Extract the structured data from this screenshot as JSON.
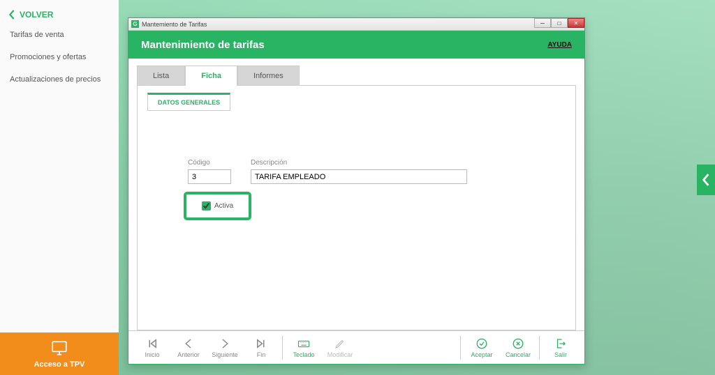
{
  "sidebar": {
    "back_label": "VOLVER",
    "items": [
      "Tarifas de venta",
      "Promociones y ofertas",
      "Actualizaciones de precios"
    ]
  },
  "tpv": {
    "label": "Acceso a TPV"
  },
  "window": {
    "titlebar_app_icon": "G",
    "titlebar_title": "Mantemiento de Tarifas",
    "header_title": "Mantenimiento de tarifas",
    "help_label": "AYUDA"
  },
  "tabs": {
    "lista": "Lista",
    "ficha": "Ficha",
    "informes": "Informes"
  },
  "subtab": {
    "datos_generales": "DATOS GENERALES"
  },
  "form": {
    "codigo_label": "Código",
    "codigo_value": "3",
    "descripcion_label": "Descripción",
    "descripcion_value": "TARIFA EMPLEADO",
    "activa_label": "Activa",
    "activa_checked": true
  },
  "toolbar": {
    "inicio": "Inicio",
    "anterior": "Anterior",
    "siguiente": "Siguiente",
    "fin": "Fin",
    "teclado": "Teclado",
    "modificar": "Modificar",
    "aceptar": "Aceptar",
    "cancelar": "Cancelar",
    "salir": "Salir"
  }
}
